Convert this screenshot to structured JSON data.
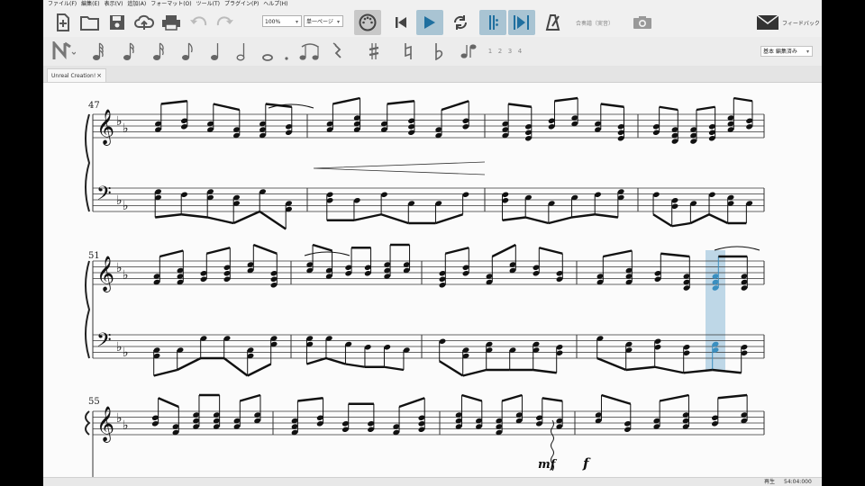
{
  "menu": [
    "ファイル(F)",
    "編集(E)",
    "表示(V)",
    "追加(A)",
    "フォーマット(O)",
    "ツール(T)",
    "プラグイン(P)",
    "ヘルプ(H)"
  ],
  "toolbar": {
    "zoom": "100%",
    "view_mode": "単一ページ",
    "mixer_label": "合奏譜（実音）",
    "feedback_label": "フィードバック",
    "icons": [
      "new-file",
      "open-folder",
      "save",
      "cloud-upload",
      "print",
      "undo",
      "redo",
      "midi-input",
      "rewind",
      "play",
      "loop",
      "play-repeats",
      "pan-score",
      "metronome",
      "image-capture",
      "feedback-envelope"
    ]
  },
  "notebar": {
    "voices": [
      "1",
      "2",
      "3",
      "4"
    ],
    "workspace": "基本 編集済み",
    "icons": [
      "note-input",
      "64th",
      "32nd",
      "16th",
      "eighth",
      "quarter",
      "half",
      "whole",
      "dot",
      "tie",
      "rest",
      "sharp",
      "natural",
      "flat",
      "flip-direction"
    ]
  },
  "tab": {
    "title": "Unreal Creation!",
    "close": "×"
  },
  "score": {
    "measure_numbers": [
      "47",
      "51",
      "55"
    ],
    "dynamics": [
      "mf",
      "f"
    ],
    "selection_color": "#a9cbe0",
    "accent_color": "#3a8fc0"
  },
  "status": {
    "mode": "再生",
    "time": "54:04:000"
  }
}
